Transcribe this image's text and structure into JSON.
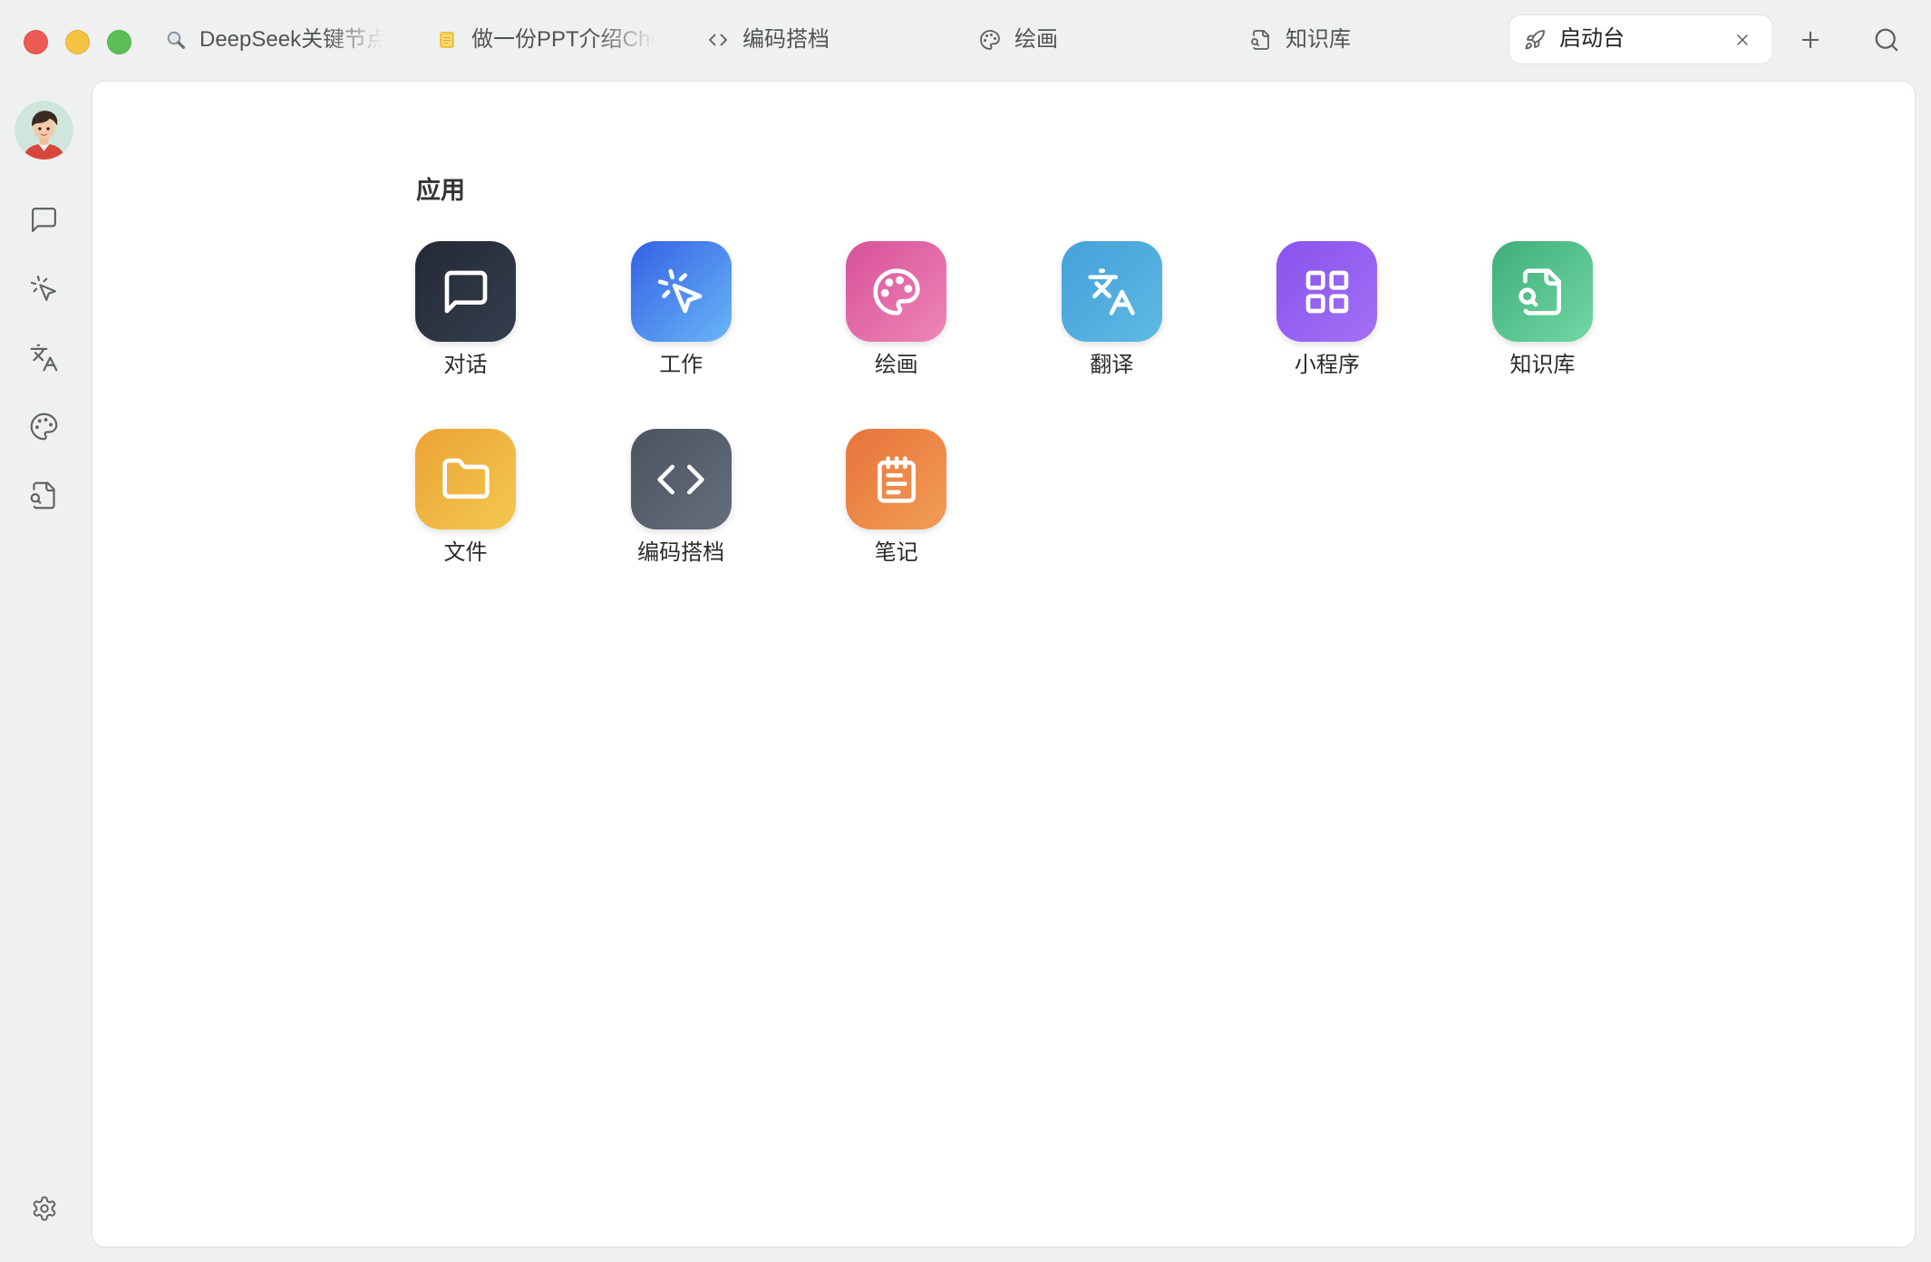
{
  "window": {
    "traffic_lights": {
      "close": "#ec5b53",
      "minimize": "#f4c344",
      "zoom": "#5bbf55"
    }
  },
  "tabs": [
    {
      "label": "DeepSeek关键节点",
      "icon": "magnifier-icon"
    },
    {
      "label": "做一份PPT介绍Che",
      "icon": "note-icon"
    },
    {
      "label": "编码搭档",
      "icon": "code-icon"
    },
    {
      "label": "绘画",
      "icon": "palette-icon"
    },
    {
      "label": "知识库",
      "icon": "file-search-icon"
    },
    {
      "label": "启动台",
      "icon": "rocket-icon",
      "active": true,
      "close_icon": "close-icon"
    }
  ],
  "toolbar": {
    "new_tab_icon": "plus-icon",
    "search_icon": "search-icon"
  },
  "sidebar": {
    "avatar_icon": "avatar-icon",
    "items": [
      {
        "icon": "message-square-icon"
      },
      {
        "icon": "pointer-click-icon"
      },
      {
        "icon": "languages-icon"
      },
      {
        "icon": "palette-icon"
      },
      {
        "icon": "file-search-icon"
      }
    ],
    "settings_icon": "gear-icon"
  },
  "launchpad": {
    "heading": "应用",
    "apps": [
      {
        "label": "对话",
        "icon": "message-square-icon",
        "colors": [
          "#232935",
          "#363e4e"
        ]
      },
      {
        "label": "工作",
        "icon": "pointer-click-icon",
        "colors": [
          "#3461e5",
          "#69b6f6"
        ]
      },
      {
        "label": "绘画",
        "icon": "palette-icon",
        "colors": [
          "#d8519a",
          "#ee86b5"
        ]
      },
      {
        "label": "翻译",
        "icon": "languages-icon",
        "colors": [
          "#44a1da",
          "#5fb9e3"
        ]
      },
      {
        "label": "小程序",
        "icon": "grid-icon",
        "colors": [
          "#8753ed",
          "#a370f5"
        ]
      },
      {
        "label": "知识库",
        "icon": "file-search-icon",
        "colors": [
          "#3fae78",
          "#72d7a4"
        ]
      },
      {
        "label": "文件",
        "icon": "folder-icon",
        "colors": [
          "#eba332",
          "#f3c851"
        ]
      },
      {
        "label": "编码搭档",
        "icon": "code-icon",
        "colors": [
          "#4b5260",
          "#666d7b"
        ]
      },
      {
        "label": "笔记",
        "icon": "notepad-icon",
        "colors": [
          "#e8733a",
          "#f19d58"
        ]
      }
    ]
  }
}
